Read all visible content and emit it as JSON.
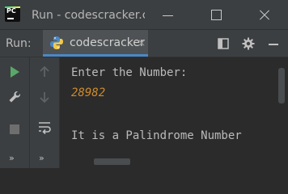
{
  "window": {
    "title": "Run - codescracker.c",
    "app_icon_text": "PC",
    "buttons": {
      "minimize": "minimize",
      "maximize": "maximize",
      "close": "close"
    }
  },
  "run_toolbar": {
    "label": "Run:",
    "tab": {
      "label": "codescracker",
      "close": "×",
      "icon": "python-icon"
    },
    "icons": [
      "layout-icon",
      "gear-icon",
      "hide-icon"
    ]
  },
  "left_gutter": {
    "icons": [
      "rerun-icon",
      "wrench-icon",
      "stop-icon",
      "more-icon"
    ]
  },
  "second_gutter": {
    "icons": [
      "up-arrow-icon",
      "down-arrow-icon",
      "soft-wrap-icon",
      "more-icon"
    ]
  },
  "console": {
    "prompt": "Enter the Number:",
    "user_input": "28982",
    "result": "It is a Palindrome Number"
  },
  "colors": {
    "background": "#2b2b2b",
    "toolbar": "#3c3f41",
    "input_text": "#cc8b2c",
    "accent": "#4a88c7",
    "run_green": "#59a869"
  }
}
